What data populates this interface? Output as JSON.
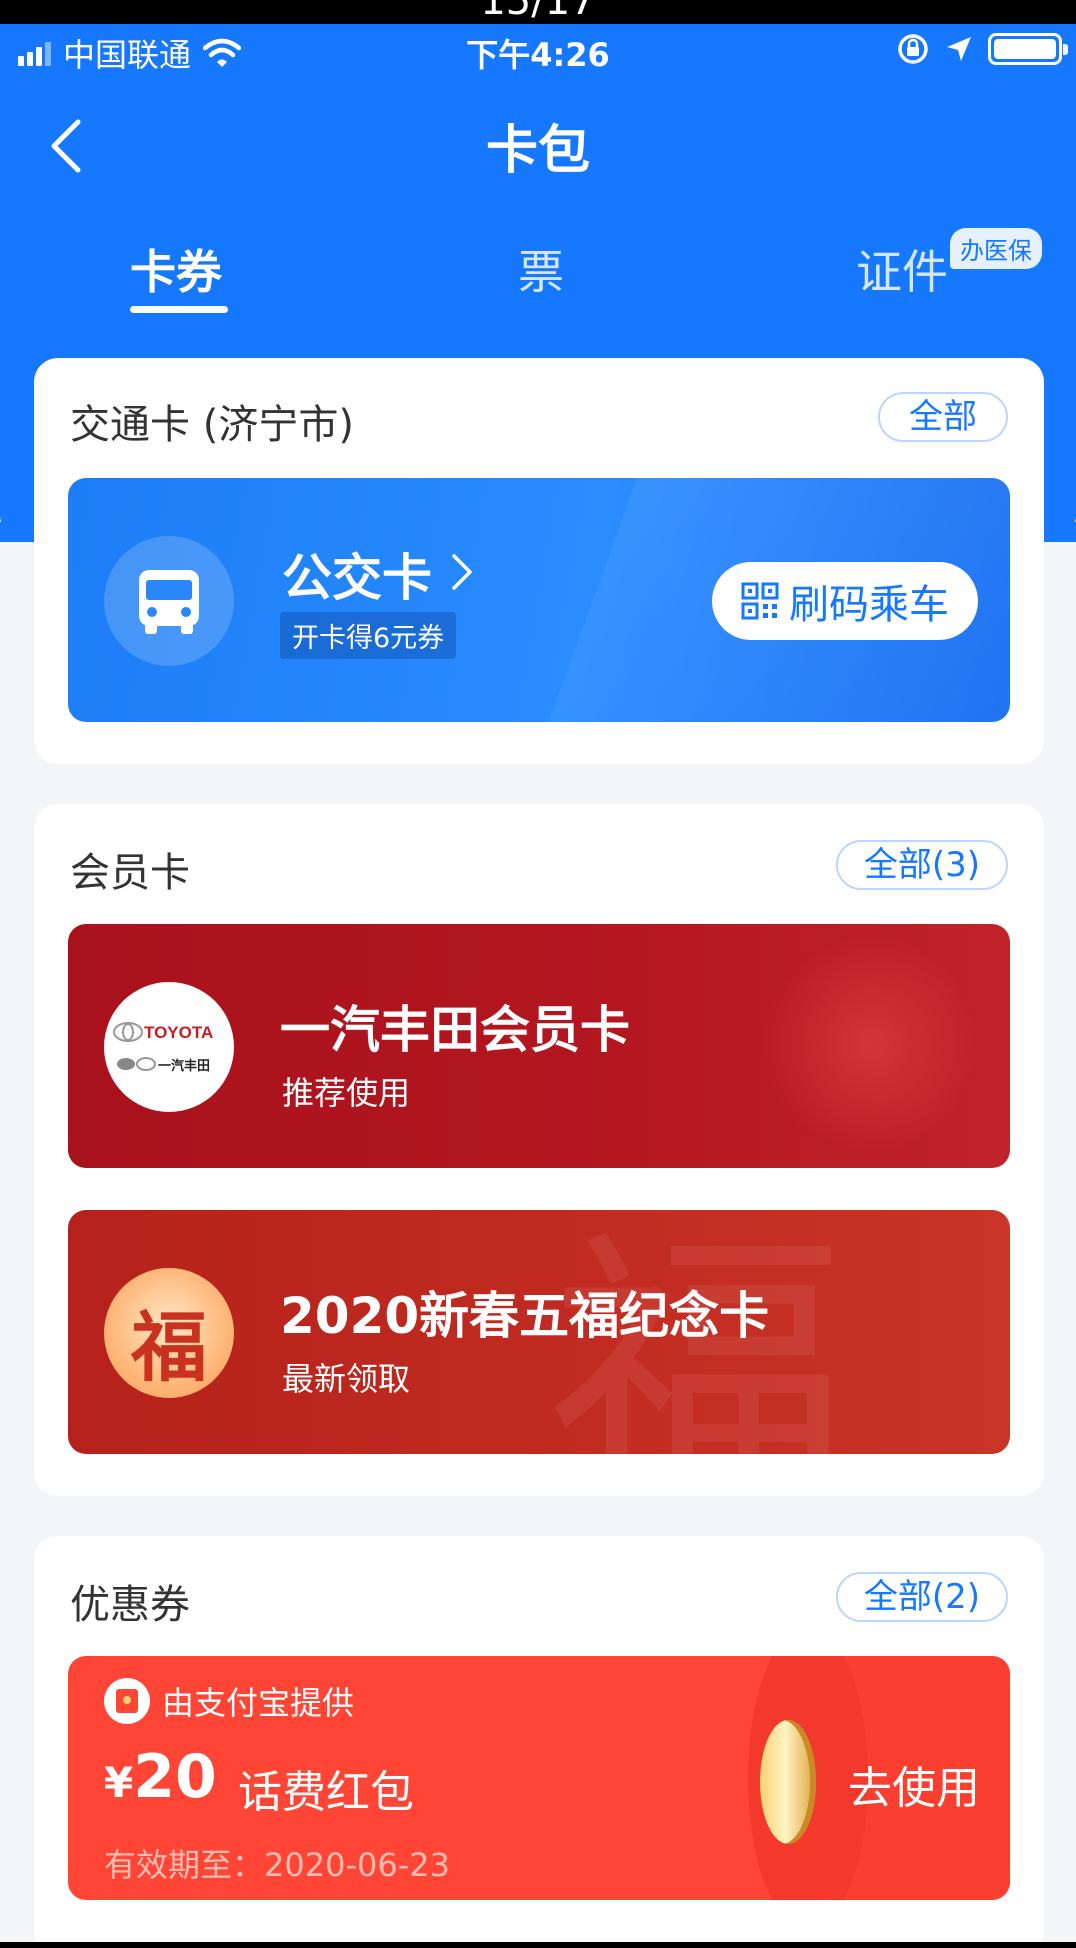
{
  "top_strip": {
    "counter": "15/17"
  },
  "status_bar": {
    "carrier": "中国联通",
    "time": "下午4:26"
  },
  "nav": {
    "title": "卡包"
  },
  "tabs": [
    {
      "label": "卡券",
      "active": true
    },
    {
      "label": "票",
      "active": false
    },
    {
      "label": "证件",
      "active": false,
      "badge": "办医保"
    }
  ],
  "transit": {
    "section_title": "交通卡 (济宁市)",
    "all_label": "全部",
    "card_title": "公交卡",
    "card_subtitle": "开卡得6元券",
    "scan_label": "刷码乘车",
    "card_color": "#1677ff"
  },
  "membership": {
    "section_title": "会员卡",
    "all_label": "全部(3)",
    "cards": [
      {
        "title": "一汽丰田会员卡",
        "subtitle": "推荐使用",
        "logo": "TOYOTA",
        "logo_sub": "一汽丰田",
        "color": "#a8121c"
      },
      {
        "title": "2020新春五福纪念卡",
        "subtitle": "最新领取",
        "logo": "福",
        "color": "#b5221b"
      }
    ]
  },
  "coupons": {
    "section_title": "优惠券",
    "all_label": "全部(2)",
    "item": {
      "provider": "由支付宝提供",
      "currency": "¥",
      "amount": "20",
      "name": "话费红包",
      "expiry": "有效期至：2020-06-23",
      "action": "去使用",
      "color": "#ff4535"
    }
  },
  "colors": {
    "accent": "#1677ff",
    "background": "#f4f5f7"
  }
}
